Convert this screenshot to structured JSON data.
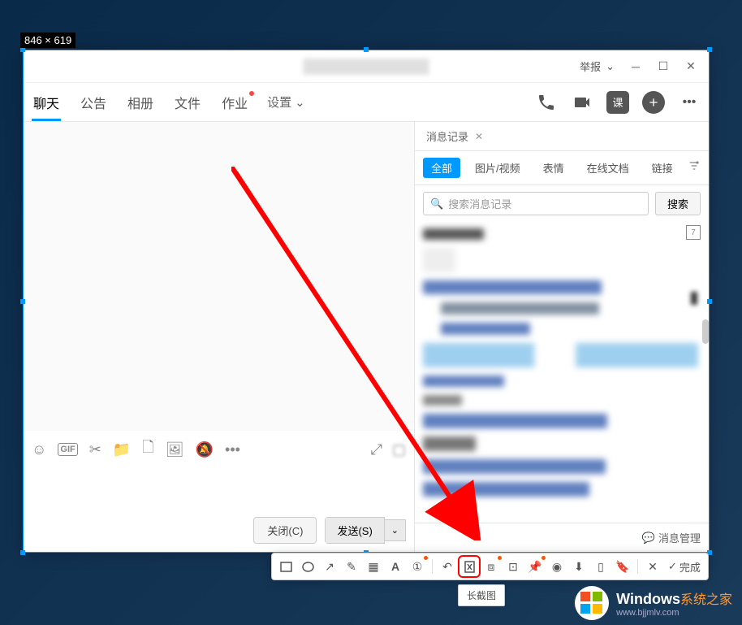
{
  "dimension_label": "846 × 619",
  "title_bar": {
    "report": "举报"
  },
  "tabs": {
    "chat": "聊天",
    "announce": "公告",
    "album": "相册",
    "file": "文件",
    "homework": "作业",
    "settings": "设置"
  },
  "action_square": "课",
  "input_gif": "GIF",
  "buttons": {
    "close": "关闭(C)",
    "send": "发送(S)"
  },
  "history": {
    "tab_label": "消息记录",
    "filters": {
      "all": "全部",
      "media": "图片/视频",
      "emoji": "表情",
      "docs": "在线文档",
      "links": "链接"
    },
    "search_placeholder": "搜索消息记录",
    "search_btn": "搜索",
    "calendar": "7",
    "manage": "消息管理"
  },
  "toolbar": {
    "done": "完成"
  },
  "tooltip": "长截图",
  "watermark": {
    "brand": "Windows",
    "suffix": "系统之家",
    "url": "www.bjjmlv.com"
  }
}
